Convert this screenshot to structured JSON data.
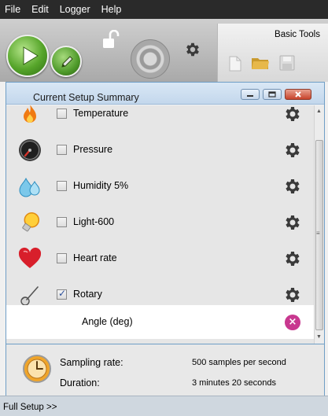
{
  "menu": [
    "File",
    "Edit",
    "Logger",
    "Help"
  ],
  "toolbar": {
    "basic_tools_label": "Basic Tools"
  },
  "panel": {
    "title": "Current Setup Summary"
  },
  "sensors": [
    {
      "label": "Temperature",
      "icon": "flame-icon",
      "checked": false
    },
    {
      "label": "Pressure",
      "icon": "gauge-icon",
      "checked": false
    },
    {
      "label": "Humidity 5%",
      "icon": "water-drops-icon",
      "checked": false
    },
    {
      "label": "Light-600",
      "icon": "light-bulb-icon",
      "checked": false
    },
    {
      "label": "Heart rate",
      "icon": "heart-icon",
      "checked": false
    },
    {
      "label": "Rotary",
      "icon": "rotary-sensor-icon",
      "checked": true,
      "count": "1"
    }
  ],
  "measurement": {
    "label": "Angle (deg)"
  },
  "summary": {
    "sampling_label": "Sampling rate:",
    "sampling_value": "500 samples per second",
    "duration_label": "Duration:",
    "duration_value": "3 minutes 20 seconds"
  },
  "footer": {
    "label": "Full Setup >>"
  },
  "colors": {
    "menu_bg": "#2a2a2a",
    "accent_green": "#4e9a2a",
    "remove_pink": "#c8388f",
    "panel_border": "#6f9ec6"
  }
}
